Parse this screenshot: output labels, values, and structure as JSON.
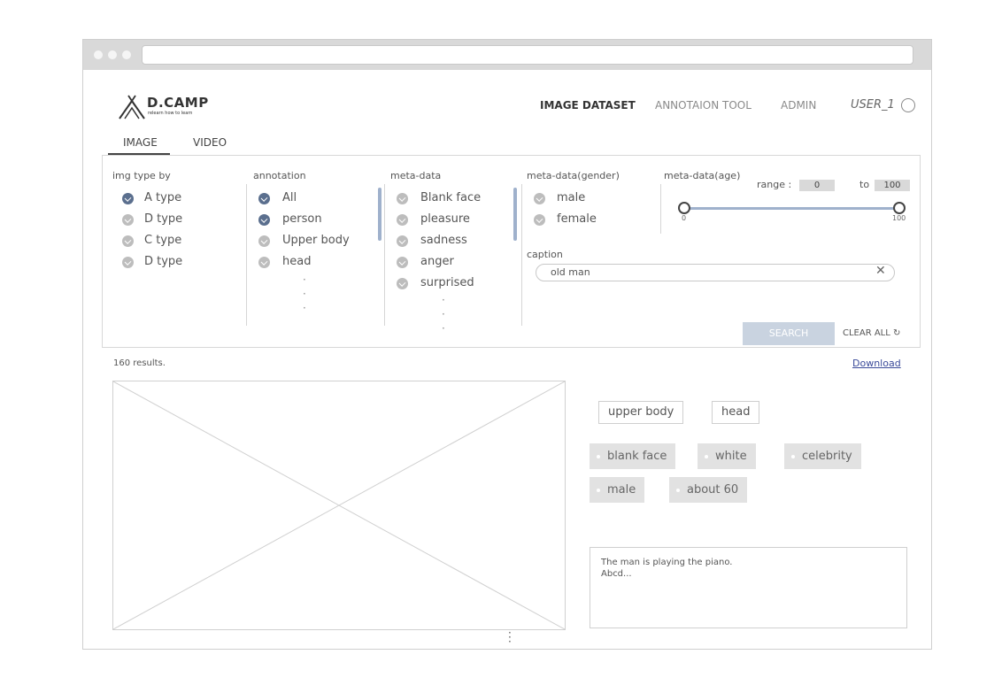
{
  "window": {
    "dots": 3
  },
  "header": {
    "logo_text": "D.CAMP",
    "logo_tagline": "relearn how to learn",
    "nav": [
      {
        "label": "IMAGE DATASET",
        "active": true
      },
      {
        "label": "ANNOTAION TOOL",
        "active": false
      },
      {
        "label": "ADMIN",
        "active": false
      }
    ],
    "user": "USER_1"
  },
  "tabs": [
    {
      "label": "IMAGE",
      "active": true
    },
    {
      "label": "VIDEO",
      "active": false
    }
  ],
  "filters": {
    "img_type": {
      "title": "img type by",
      "options": [
        {
          "label": "A type",
          "checked": true
        },
        {
          "label": "D type",
          "checked": false
        },
        {
          "label": "C type",
          "checked": false
        },
        {
          "label": "D type",
          "checked": false
        }
      ]
    },
    "annotation": {
      "title": "annotation",
      "options": [
        {
          "label": "All",
          "checked": true
        },
        {
          "label": "person",
          "checked": true
        },
        {
          "label": "Upper body",
          "checked": false
        },
        {
          "label": "head",
          "checked": false
        }
      ],
      "more": [
        "·",
        "·",
        "·"
      ]
    },
    "meta_data": {
      "title": "meta-data",
      "options": [
        {
          "label": "Blank face",
          "checked": false
        },
        {
          "label": "pleasure",
          "checked": false
        },
        {
          "label": "sadness",
          "checked": false
        },
        {
          "label": "anger",
          "checked": false
        },
        {
          "label": "surprised",
          "checked": false
        }
      ],
      "more": [
        "·",
        "·",
        "·"
      ]
    },
    "gender": {
      "title": "meta-data(gender)",
      "options": [
        {
          "label": "male",
          "checked": false
        },
        {
          "label": "female",
          "checked": false
        }
      ]
    },
    "age": {
      "title": "meta-data(age)",
      "range_label": "range :",
      "from": "0",
      "to_label": "to",
      "to": "100",
      "slider_min": "0",
      "slider_max": "100"
    },
    "caption": {
      "label": "caption",
      "value": "old man",
      "clear": "✕"
    },
    "search_label": "SEARCH",
    "clear_all_label": "CLEAR ALL ↻"
  },
  "results": {
    "count_text": "160 results.",
    "download_label": "Download"
  },
  "detail": {
    "annotation_tags": [
      "upper body",
      "head"
    ],
    "meta_tags": [
      "blank face",
      "white",
      "celebrity",
      "male",
      "about 60"
    ],
    "description_line1": "The man is playing the piano.",
    "description_line2": "Abcd..."
  }
}
